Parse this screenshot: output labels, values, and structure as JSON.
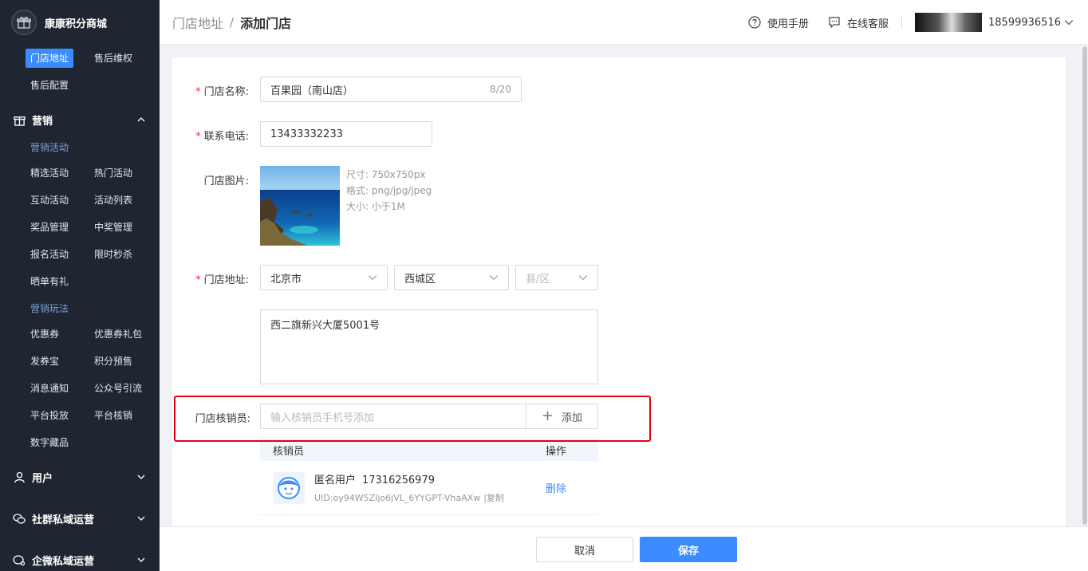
{
  "brand": {
    "name": "康康积分商城"
  },
  "sidebar": {
    "top_items": [
      {
        "label": "门店地址",
        "active": true
      },
      {
        "label": "售后维权",
        "active": false
      },
      {
        "label": "售后配置",
        "active": false
      }
    ],
    "marketing": {
      "title": "营销",
      "group1_title": "营销活动",
      "group1_items": [
        "精选活动",
        "热门活动",
        "互动活动",
        "活动列表",
        "奖品管理",
        "中奖管理",
        "报名活动",
        "限时秒杀",
        "晒单有礼"
      ],
      "group2_title": "营销玩法",
      "group2_items": [
        "优惠券",
        "优惠券礼包",
        "发券宝",
        "积分预售",
        "消息通知",
        "公众号引流",
        "平台投放",
        "平台核销",
        "数字藏品"
      ]
    },
    "sections": [
      {
        "label": "用户",
        "icon": "user-icon"
      },
      {
        "label": "社群私域运营",
        "icon": "wechat-icon"
      },
      {
        "label": "企微私域运营",
        "icon": "wecom-icon"
      }
    ]
  },
  "header": {
    "breadcrumb_parent": "门店地址",
    "breadcrumb_sep": "/",
    "breadcrumb_current": "添加门店",
    "manual": "使用手册",
    "service": "在线客服",
    "account": "18599936516"
  },
  "form": {
    "name_label": "门店名称:",
    "name_value": "百果园（南山店）",
    "name_counter": "8/20",
    "phone_label": "联系电话:",
    "phone_value": "13433332233",
    "image_label": "门店图片:",
    "image_hints": [
      "尺寸: 750x750px",
      "格式: png/jpg/jpeg",
      "大小: 小于1M"
    ],
    "address_label": "门店地址:",
    "province": "北京市",
    "city": "西城区",
    "county_placeholder": "县/区",
    "address_detail": "西二旗新兴大厦5001号",
    "verifier_label": "门店核销员:",
    "verifier_placeholder": "输入核销员手机号添加",
    "add_button": "添加",
    "required_mark": "*"
  },
  "table": {
    "col_name": "核销员",
    "col_op": "操作",
    "rows": [
      {
        "name": "匿名用户",
        "phone": "17316256979",
        "uid": "UID:oy94W5ZIjo6jVL_6YYGPT-VhaAXw",
        "copy": "|复制",
        "op": "删除"
      }
    ]
  },
  "footer": {
    "cancel": "取消",
    "save": "保存"
  },
  "colors": {
    "sidebar_bg": "#1f2632",
    "primary": "#3b8cff",
    "highlight": "#e60012",
    "required": "#f5222d"
  }
}
